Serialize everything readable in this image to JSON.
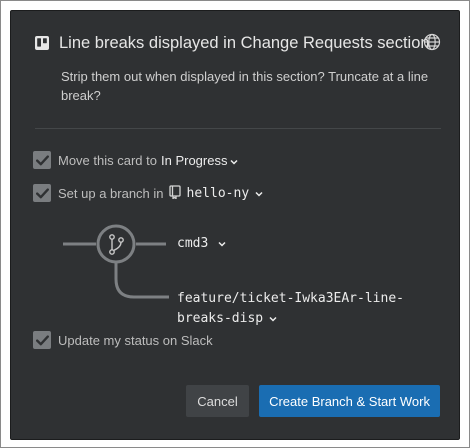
{
  "header": {
    "title": "Line breaks displayed in Change Requests section"
  },
  "description": "Strip them out when displayed in this section? Truncate at a line break?",
  "options": {
    "move_card": {
      "label": "Move this card to",
      "value": "In Progress",
      "checked": true
    },
    "branch": {
      "label": "Set up a branch in",
      "repo": "hello-ny",
      "checked": true
    },
    "slack": {
      "label": "Update my status on Slack",
      "checked": true
    }
  },
  "branch_diagram": {
    "base_branch": "cmd3",
    "new_branch_line1": "feature/ticket-Iwka3EAr-line-",
    "new_branch_line2": "breaks-disp"
  },
  "buttons": {
    "cancel": "Cancel",
    "primary": "Create Branch & Start Work"
  },
  "colors": {
    "dialog_bg": "#2f3133",
    "primary": "#1a6db2",
    "checkbox": "#7a7d80"
  }
}
